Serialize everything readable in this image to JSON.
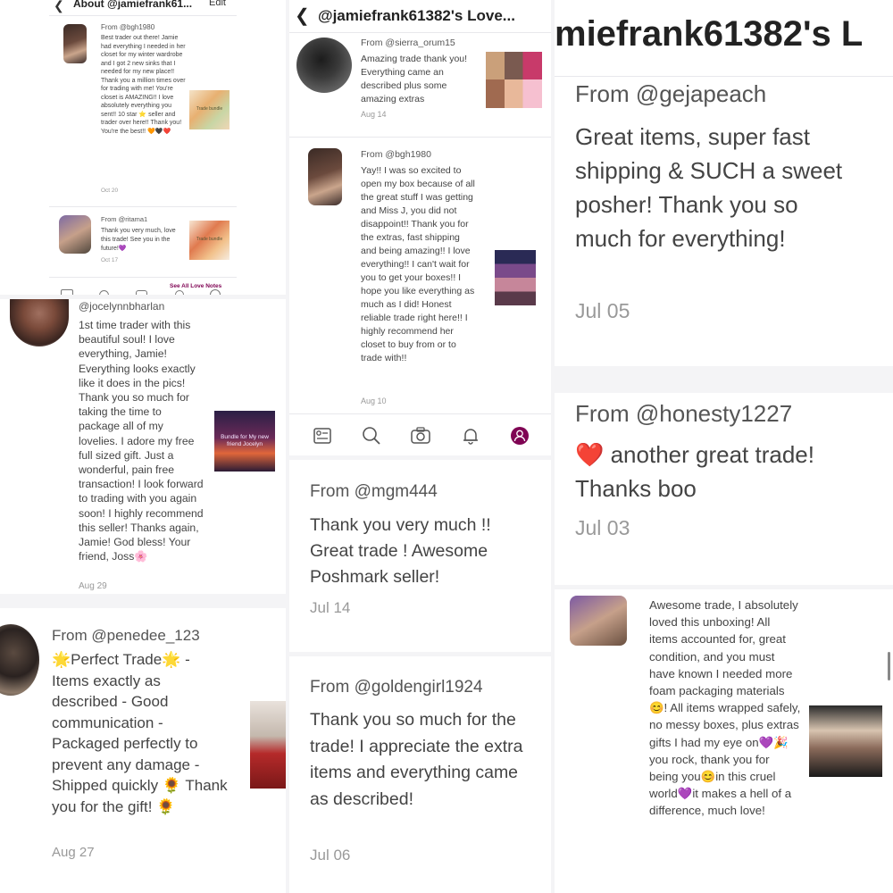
{
  "colors": {
    "accent": "#7f0353",
    "heart": "#e02424",
    "purple": "#8b2fd9",
    "sun": "#f3b52a"
  },
  "panel_tl": {
    "header": {
      "title": "About @jamiefrank61...",
      "edit": "Edit"
    },
    "notes": [
      {
        "from": "From @bgh1980",
        "text": "Best trader out there! Jamie had everything I needed in her closet for my winter wardrobe and I got 2 new sinks that I needed for my new place!! Thank you a million times over for trading with me! You're closet is AMAZING!! I love absolutely everything you sent!! 10 star ⭐ seller and trader over here!! Thank you! You're the best!! 🧡🖤❤️",
        "date": "Oct 20",
        "thumb_label": "Trade bundle"
      },
      {
        "from": "From @ritama1",
        "text": "Thank you very much, love this trade! See you in the future!💜",
        "date": "Oct 17",
        "thumb_label": "Trade bundle"
      }
    ],
    "see_all": "See All Love Notes"
  },
  "panel_ml": {
    "user": "@jocelynnbharlan",
    "text": "1st time trader with this beautiful soul! I love everything, Jamie! Everything looks exactly like it does in the pics! Thank you so much for taking the time to package all of my lovelies. I adore my free full sized gift. Just a wonderful, pain free transaction! I look forward to trading with you again soon! I highly recommend this seller! Thanks again, Jamie! God bless! Your friend, Joss🌸",
    "date": "Aug 29",
    "thumb_label": "Bundle for My new friend Jocelyn"
  },
  "panel_bl": {
    "from": "From @penedee_123",
    "text": "🌟Perfect Trade🌟 - Items exactly as described - Good communication - Packaged perfectly to prevent any damage - Shipped quickly 🌻 Thank you for the gift! 🌻",
    "date": "Aug 27"
  },
  "panel_tm": {
    "title": "@jamiefrank61382's Love...",
    "notes": [
      {
        "from": "From @sierra_orum15",
        "text": "Amazing trade thank you! Everything came an described plus some amazing extras",
        "date": "Aug 14"
      },
      {
        "from": "From @bgh1980",
        "text": "Yay!! I was so excited to open my box because of all the great stuff I was getting and Miss J, you did not disappoint!! Thank you for the extras, fast shipping and being amazing!! I love everything!! I can't wait for you to get your boxes!! I hope you like everything as much as I did! Honest reliable trade right here!! I highly recommend her closet to buy from or to trade with!!",
        "date": "Aug 10"
      }
    ],
    "nav_icons": [
      "feed-icon",
      "search-icon",
      "camera-icon",
      "bell-icon",
      "profile-icon"
    ]
  },
  "panel_mm": {
    "from": "From @mgm444",
    "text": "Thank you very much !! Great trade ! Awesome Poshmark seller!",
    "date": "Jul 14"
  },
  "panel_bm": {
    "from": "From @goldengirl1924",
    "text": "Thank you so much for the trade! I appreciate the extra items and everything came as described!",
    "date": "Jul 06"
  },
  "panel_tr": {
    "title": "miefrank61382's L",
    "notes": [
      {
        "from": "From @gejapeach",
        "text": "Great items, super fast shipping & SUCH a sweet posher! Thank you so much for everything!",
        "date": "Jul 05"
      },
      {
        "from": "From @honesty1227",
        "text": "❤️ another great trade! Thanks boo",
        "date": "Jul 03"
      }
    ]
  },
  "panel_br": {
    "text": "Awesome trade, I absolutely loved this unboxing! All items accounted for, great condition, and you must have known I needed more foam packaging materials😊! All items wrapped safely, no messy boxes, plus extras gifts I had my eye on💜🎉you rock, thank you for being you😊in this cruel world💜it makes a hell of a difference, much love!"
  }
}
